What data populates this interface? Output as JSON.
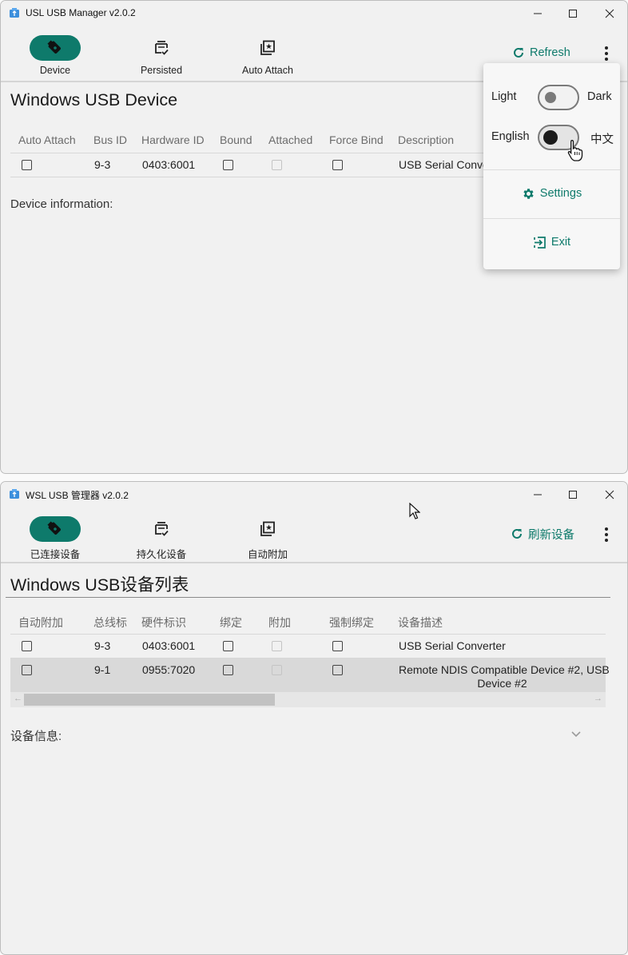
{
  "window1": {
    "title": "USL USB Manager v2.0.2",
    "nav": [
      {
        "label": "Device",
        "icon": "usb-drive-icon",
        "active": true
      },
      {
        "label": "Persisted",
        "icon": "persisted-icon",
        "active": false
      },
      {
        "label": "Auto Attach",
        "icon": "auto-attach-icon",
        "active": false
      }
    ],
    "refresh_label": "Refresh",
    "page_title": "Windows USB Device",
    "columns": [
      "Auto Attach",
      "Bus ID",
      "Hardware ID",
      "Bound",
      "Attached",
      "Force Bind",
      "Description"
    ],
    "rows": [
      {
        "bus_id": "9-3",
        "hardware_id": "0403:6001",
        "description": "USB Serial Conve"
      }
    ],
    "device_info_label": "Device information:",
    "menu": {
      "theme_off_label": "Light",
      "theme_on_label": "Dark",
      "lang_off_label": "English",
      "lang_on_label": "中文",
      "settings_label": "Settings",
      "exit_label": "Exit"
    }
  },
  "window2": {
    "title": "WSL USB 管理器 v2.0.2",
    "nav": [
      {
        "label": "已连接设备",
        "icon": "usb-drive-icon",
        "active": true
      },
      {
        "label": "持久化设备",
        "icon": "persisted-icon",
        "active": false
      },
      {
        "label": "自动附加",
        "icon": "auto-attach-icon",
        "active": false
      }
    ],
    "refresh_label": "刷新设备",
    "page_title": "Windows USB设备列表",
    "columns": [
      "自动附加",
      "总线标",
      "硬件标识",
      "绑定",
      "附加",
      "强制绑定",
      "设备描述"
    ],
    "rows": [
      {
        "bus_id": "9-3",
        "hardware_id": "0403:6001",
        "description": "USB Serial Converter"
      },
      {
        "bus_id": "9-1",
        "hardware_id": "0955:7020",
        "description_line1": "Remote NDIS Compatible Device #2, USB",
        "description_line2": "Device #2"
      }
    ],
    "device_info_label": "设备信息:"
  },
  "colors": {
    "accent": "#0e7a6b",
    "window_bg": "#f1f1f1",
    "selected_row": "#d9d9d9"
  }
}
